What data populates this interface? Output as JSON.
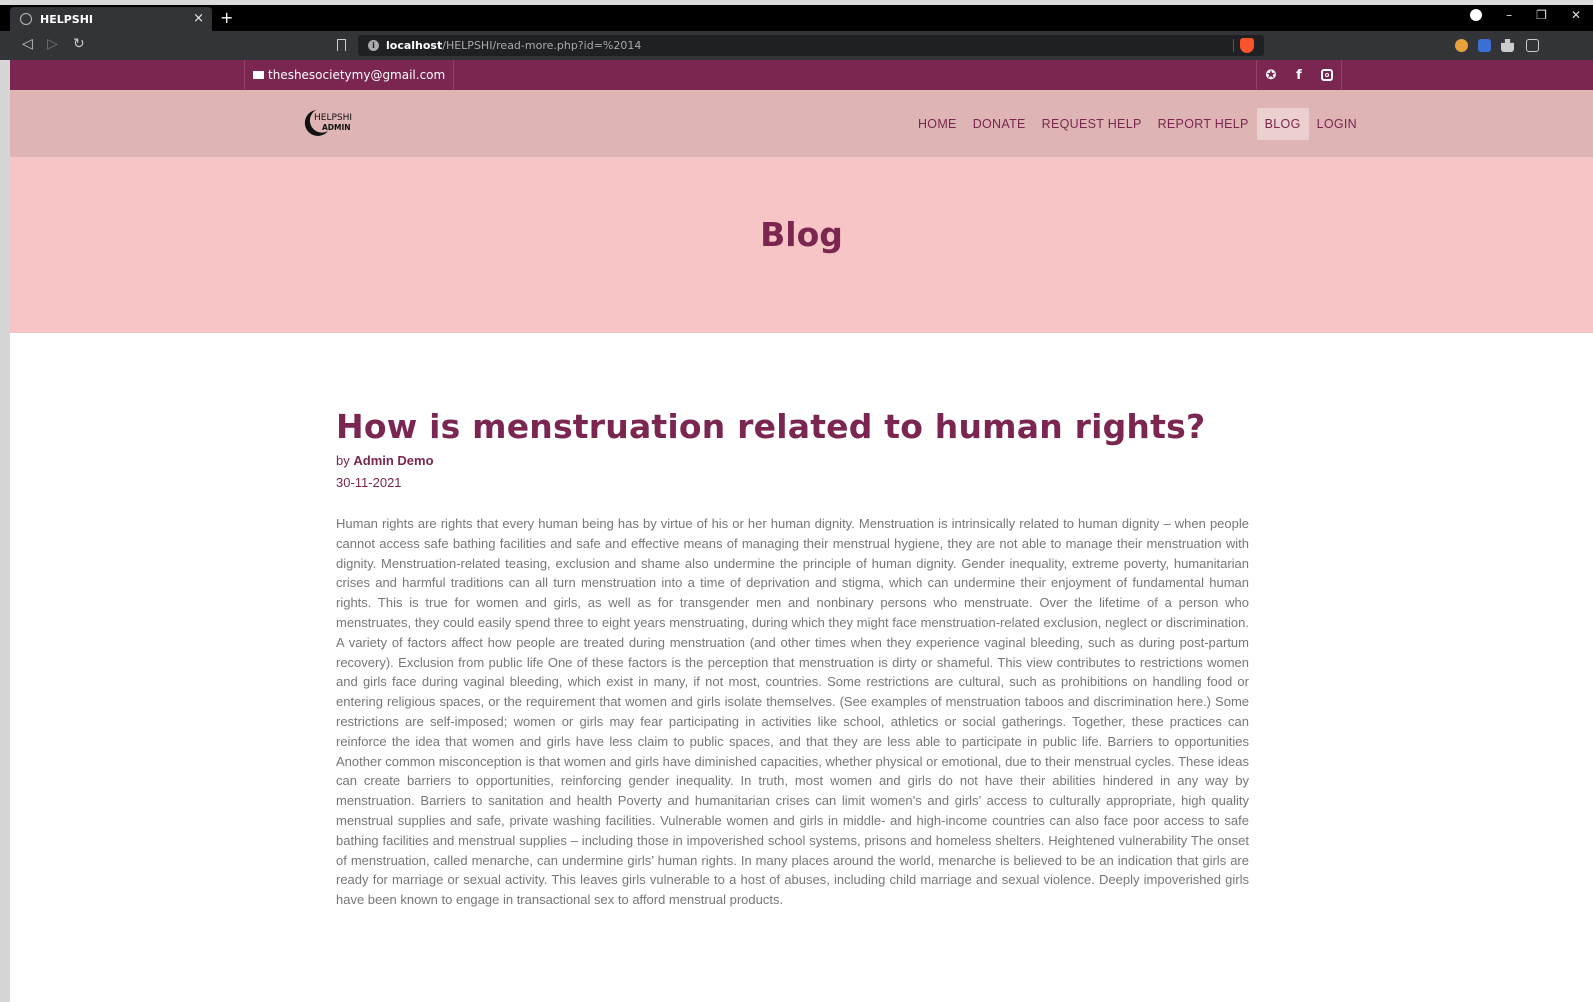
{
  "browser": {
    "tab_title": "HELPSHI",
    "tab_close": "×",
    "new_tab": "+",
    "url_host": "localhost",
    "url_path": "/HELPSHI/read-more.php?id=%2014"
  },
  "topbar": {
    "email": "theshesocietymy@gmail.com",
    "socials": [
      "twitter-icon",
      "facebook-icon",
      "instagram-icon"
    ]
  },
  "logo": {
    "line1": "HELPSHI",
    "line2": "ADMIN"
  },
  "nav": {
    "items": [
      {
        "label": "HOME",
        "active": false
      },
      {
        "label": "DONATE",
        "active": false
      },
      {
        "label": "REQUEST HELP",
        "active": false
      },
      {
        "label": "REPORT HELP",
        "active": false
      },
      {
        "label": "BLOG",
        "active": true
      },
      {
        "label": "LOGIN",
        "active": false
      }
    ]
  },
  "hero": {
    "title": "Blog"
  },
  "article": {
    "title": "How is menstruation related to human rights?",
    "by_prefix": "by",
    "author": "Admin Demo",
    "date": "30-11-2021",
    "body": "Human rights are rights that every human being has by virtue of his or her human dignity. Menstruation is intrinsically related to human dignity – when people cannot access safe bathing facilities and safe and effective means of managing their menstrual hygiene, they are not able to manage their menstruation with dignity. Menstruation-related teasing, exclusion and shame also undermine the principle of human dignity. Gender inequality, extreme poverty, humanitarian crises and harmful traditions can all turn menstruation into a time of deprivation and stigma, which can undermine their enjoyment of fundamental human rights. This is true for women and girls, as well as for transgender men and nonbinary persons who menstruate. Over the lifetime of a person who menstruates, they could easily spend three to eight years menstruating, during which they might face menstruation-related exclusion, neglect or discrimination. A variety of factors affect how people are treated during menstruation (and other times when they experience vaginal bleeding, such as during post-partum recovery). Exclusion from public life One of these factors is the perception that menstruation is dirty or shameful. This view contributes to restrictions women and girls face during vaginal bleeding, which exist in many, if not most, countries. Some restrictions are cultural, such as prohibitions on handling food or entering religious spaces, or the requirement that women and girls isolate themselves. (See examples of menstruation taboos and discrimination here.) Some restrictions are self-imposed; women or girls may fear participating in activities like school, athletics or social gatherings. Together, these practices can reinforce the idea that women and girls have less claim to public spaces, and that they are less able to participate in public life. Barriers to opportunities Another common misconception is that women and girls have diminished capacities, whether physical or emotional, due to their menstrual cycles. These ideas can create barriers to opportunities, reinforcing gender inequality. In truth, most women and girls do not have their abilities hindered in any way by menstruation. Barriers to sanitation and health Poverty and humanitarian crises can limit women’s and girls’ access to culturally appropriate, high quality menstrual supplies and safe, private washing facilities. Vulnerable women and girls in middle- and high-income countries can also face poor access to safe bathing facilities and menstrual supplies – including those in impoverished school systems, prisons and homeless shelters. Heightened vulnerability The onset of menstruation, called menarche, can undermine girls’ human rights. In many places around the world, menarche is believed to be an indication that girls are ready for marriage or sexual activity. This leaves girls vulnerable to a host of abuses, including child marriage and sexual violence. Deeply impoverished girls have been known to engage in transactional sex to afford menstrual products."
  },
  "colors": {
    "brand": "#7a2650",
    "navbar_bg": "#deb5b4",
    "hero_bg": "#f7c5c5",
    "body_text": "#777777"
  }
}
